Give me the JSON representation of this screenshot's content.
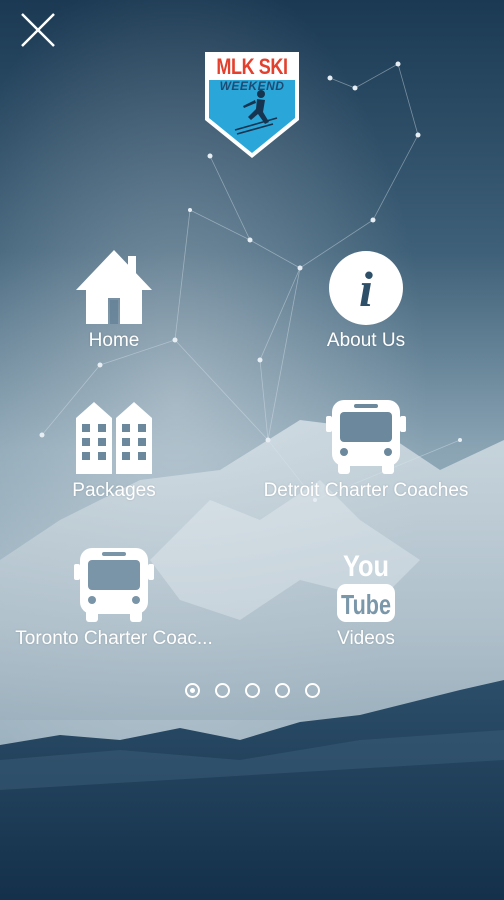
{
  "colors": {
    "sky_top": "#1c3a55",
    "sky_mid": "#7b98aa",
    "mountain_light": "#c9d6de",
    "foreground_dark": "#15324d",
    "logo_red": "#e3402d",
    "logo_blue": "#2aa6d8"
  },
  "close_button": {
    "icon": "close-icon"
  },
  "logo": {
    "line1": "MLK SKI",
    "line2": "WEEKEND",
    "icon": "skier-icon"
  },
  "menu": {
    "items": [
      {
        "label": "Home",
        "icon": "home-icon"
      },
      {
        "label": "About Us",
        "icon": "info-icon"
      },
      {
        "label": "Packages",
        "icon": "buildings-icon"
      },
      {
        "label": "Detroit Charter Coaches",
        "icon": "bus-icon"
      },
      {
        "label": "Toronto Charter Coac...",
        "icon": "bus-icon"
      },
      {
        "label": "Videos",
        "icon": "youtube-icon"
      }
    ]
  },
  "pagination": {
    "pages": 5,
    "current": 1
  }
}
